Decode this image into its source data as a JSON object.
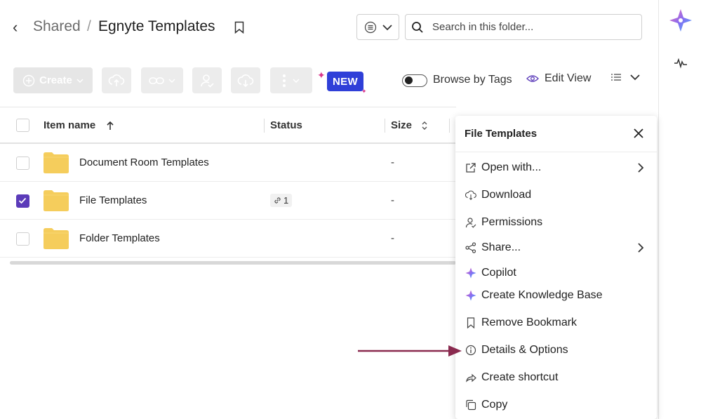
{
  "breadcrumb": {
    "parent": "Shared",
    "separator": "/",
    "current": "Egnyte Templates"
  },
  "search": {
    "placeholder": "Search in this folder..."
  },
  "toolbar": {
    "create_label": "Create",
    "new_badge": "NEW",
    "browse_by_tags": "Browse by Tags",
    "edit_view": "Edit View"
  },
  "table": {
    "columns": {
      "name": "Item name",
      "status": "Status",
      "size": "Size"
    },
    "rows": [
      {
        "name": "Document Room Templates",
        "size": "-",
        "checked": false
      },
      {
        "name": "File Templates",
        "size": "-",
        "checked": true,
        "status_links": "1"
      },
      {
        "name": "Folder Templates",
        "size": "-",
        "checked": false
      }
    ]
  },
  "context_menu": {
    "title": "File Templates",
    "items": [
      {
        "label": "Open with...",
        "icon": "external-link-icon"
      },
      {
        "label": "Download",
        "icon": "cloud-download-icon"
      },
      {
        "label": "Permissions",
        "icon": "user-check-icon"
      },
      {
        "label": "Share...",
        "icon": "share-icon"
      },
      {
        "label": "Copilot",
        "icon": "sparkle-icon"
      },
      {
        "label": "Create Knowledge Base",
        "icon": "sparkle-icon"
      },
      {
        "label": "Remove Bookmark",
        "icon": "bookmark-icon"
      },
      {
        "label": "Details & Options",
        "icon": "info-icon"
      },
      {
        "label": "Create shortcut",
        "icon": "shortcut-icon"
      },
      {
        "label": "Copy",
        "icon": "copy-icon"
      }
    ]
  },
  "colors": {
    "accent": "#5b3bb9",
    "new_badge": "#2f3fd8",
    "annotation_arrow": "#8a2a4f",
    "folder": "#f5cd5c"
  }
}
